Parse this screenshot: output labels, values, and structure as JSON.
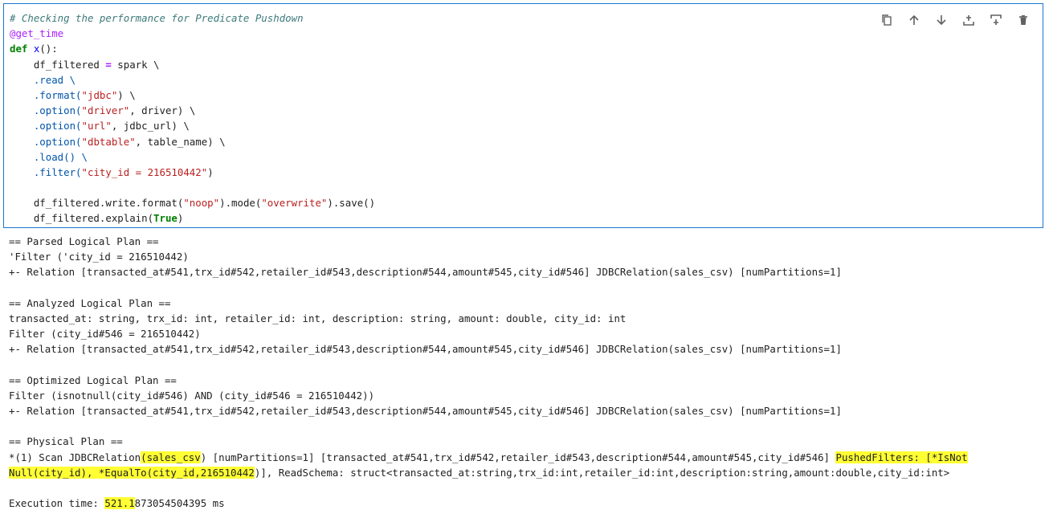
{
  "code_cell": {
    "lines": [
      "# Checking the performance for Predicate Pushdown",
      "@get_time",
      "def",
      "x",
      "():",
      "    df_filtered ",
      "=",
      " spark \\",
      "    .read \\",
      "    .format(",
      "\"jdbc\"",
      ") \\",
      "    .option(",
      "\"driver\"",
      ", driver) \\",
      "    .option(",
      "\"url\"",
      ", jdbc_url) \\",
      "    .option(",
      "\"dbtable\"",
      ", table_name) \\",
      "    .load() \\",
      "    .filter(",
      "\"city_id = 216510442\"",
      ")",
      "    df_filtered.write.format(",
      "\"noop\"",
      ").mode(",
      "\"overwrite\"",
      ").save()",
      "    df_filtered.explain(",
      "True",
      ")"
    ]
  },
  "toolbar": {
    "icons": [
      "copy-icon",
      "move-up-icon",
      "move-down-icon",
      "insert-above-icon",
      "insert-below-icon",
      "delete-icon"
    ]
  },
  "output": {
    "parsed_header": "== Parsed Logical Plan ==",
    "parsed_1": "'Filter ('city_id = 216510442)",
    "parsed_2": "+- Relation [transacted_at#541,trx_id#542,retailer_id#543,description#544,amount#545,city_id#546] JDBCRelation(sales_csv) [numPartitions=1]",
    "analyzed_header": "== Analyzed Logical Plan ==",
    "analyzed_1": "transacted_at: string, trx_id: int, retailer_id: int, description: string, amount: double, city_id: int",
    "analyzed_2": "Filter (city_id#546 = 216510442)",
    "analyzed_3": "+- Relation [transacted_at#541,trx_id#542,retailer_id#543,description#544,amount#545,city_id#546] JDBCRelation(sales_csv) [numPartitions=1]",
    "optimized_header": "== Optimized Logical Plan ==",
    "optimized_1": "Filter (isnotnull(city_id#546) AND (city_id#546 = 216510442))",
    "optimized_2": "+- Relation [transacted_at#541,trx_id#542,retailer_id#543,description#544,amount#545,city_id#546] JDBCRelation(sales_csv) [numPartitions=1]",
    "physical_header": "== Physical Plan ==",
    "physical_1a": "*(1) Scan JDBCRelation",
    "physical_1b": "(sales_csv",
    "physical_1c": ") [numPartitions=1] [transacted_at#541,trx_id#542,retailer_id#543,description#544,amount#545,city_id#546] ",
    "physical_1d": "PushedFilters: [*IsNot",
    "physical_2a": "Null(city_id), *EqualTo(city_id,216510442",
    "physical_2b": ")], ReadSchema: struct<transacted_at:string,trx_id:int,retailer_id:int,description:string,amount:double,city_id:int>",
    "exec_label": "Execution time: ",
    "exec_hl": "521.1",
    "exec_rest": "873054504395 ms"
  }
}
